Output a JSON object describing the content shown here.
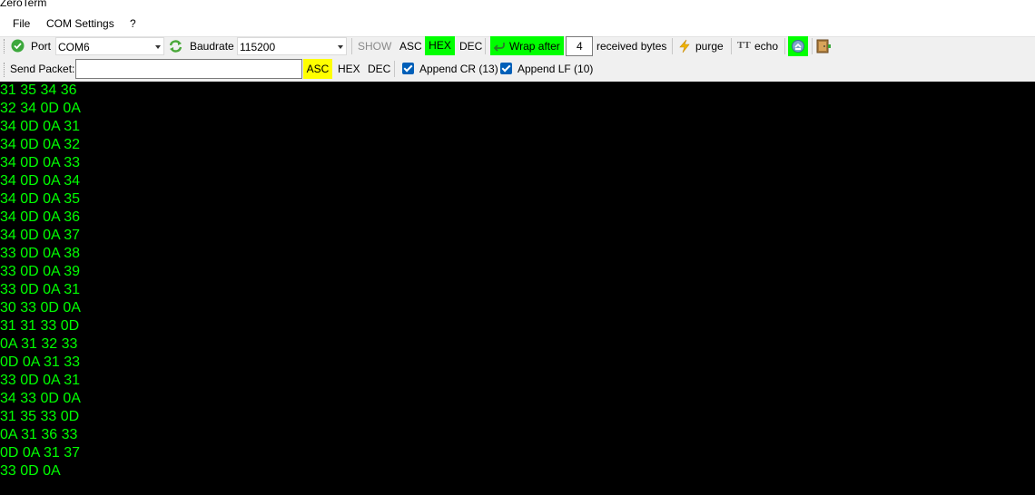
{
  "window": {
    "title": "ZeroTerm"
  },
  "menu": {
    "file": "File",
    "com_settings": "COM Settings",
    "help": "?"
  },
  "toolbar1": {
    "port_label": "Port",
    "port_value": "COM6",
    "baudrate_label": "Baudrate",
    "baudrate_value": "115200",
    "show_label": "SHOW",
    "asc_label": "ASC",
    "hex_label": "HEX",
    "dec_label": "DEC",
    "wrap_label": "Wrap after",
    "wrap_value": "4",
    "received_label": "received bytes",
    "purge_label": "purge",
    "echo_label": "echo"
  },
  "toolbar2": {
    "send_label": "Send Packet:",
    "send_value": "",
    "asc_label": "ASC",
    "hex_label": "HEX",
    "dec_label": "DEC",
    "append_cr_label": "Append CR (13)",
    "append_cr_checked": true,
    "append_lf_label": "Append LF (10)",
    "append_lf_checked": true
  },
  "terminal": {
    "lines": [
      "31 35 34 36",
      "32 34 0D 0A",
      "34 0D 0A 31",
      "34 0D 0A 32",
      "34 0D 0A 33",
      "34 0D 0A 34",
      "34 0D 0A 35",
      "34 0D 0A 36",
      "34 0D 0A 37",
      "33 0D 0A 38",
      "33 0D 0A 39",
      "33 0D 0A 31",
      "30 33 0D 0A",
      "31 31 33 0D",
      "0A 31 32 33",
      "0D 0A 31 33",
      "33 0D 0A 31",
      "34 33 0D 0A",
      "31 35 33 0D",
      "0A 31 36 33",
      "0D 0A 31 37",
      "33 0D 0A"
    ]
  },
  "colors": {
    "terminal_bg": "#000000",
    "terminal_fg": "#00ff00",
    "active_mode": "#00ff00",
    "send_mode": "#ffff00"
  }
}
